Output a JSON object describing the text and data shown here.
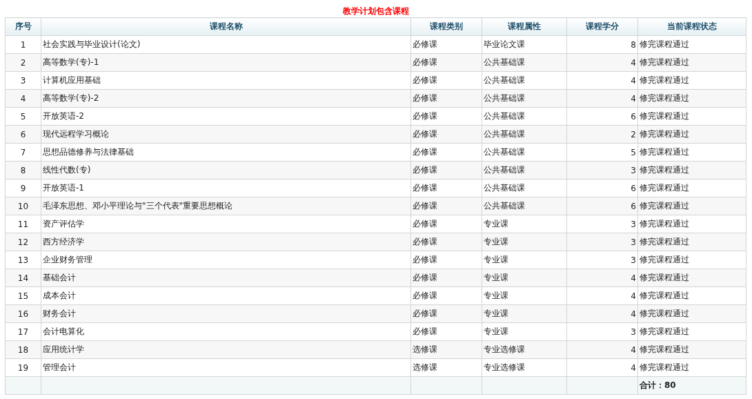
{
  "title": "教学计划包含课程",
  "table": {
    "columns": [
      "序号",
      "课程名称",
      "课程类别",
      "课程属性",
      "课程学分",
      "当前课程状态"
    ],
    "rows": [
      [
        "1",
        "社会实践与毕业设计(论文)",
        "必修课",
        "毕业论文课",
        "8",
        "修完课程通过"
      ],
      [
        "2",
        "高等数学(专)-1",
        "必修课",
        "公共基础课",
        "4",
        "修完课程通过"
      ],
      [
        "3",
        "计算机应用基础",
        "必修课",
        "公共基础课",
        "4",
        "修完课程通过"
      ],
      [
        "4",
        "高等数学(专)-2",
        "必修课",
        "公共基础课",
        "4",
        "修完课程通过"
      ],
      [
        "5",
        "开放英语-2",
        "必修课",
        "公共基础课",
        "6",
        "修完课程通过"
      ],
      [
        "6",
        "现代远程学习概论",
        "必修课",
        "公共基础课",
        "2",
        "修完课程通过"
      ],
      [
        "7",
        "思想品德修养与法律基础",
        "必修课",
        "公共基础课",
        "5",
        "修完课程通过"
      ],
      [
        "8",
        "线性代数(专)",
        "必修课",
        "公共基础课",
        "3",
        "修完课程通过"
      ],
      [
        "9",
        "开放英语-1",
        "必修课",
        "公共基础课",
        "6",
        "修完课程通过"
      ],
      [
        "10",
        "毛泽东思想、邓小平理论与\"三个代表\"重要思想概论",
        "必修课",
        "公共基础课",
        "6",
        "修完课程通过"
      ],
      [
        "11",
        "资产评估学",
        "必修课",
        "专业课",
        "3",
        "修完课程通过"
      ],
      [
        "12",
        "西方经济学",
        "必修课",
        "专业课",
        "3",
        "修完课程通过"
      ],
      [
        "13",
        "企业财务管理",
        "必修课",
        "专业课",
        "3",
        "修完课程通过"
      ],
      [
        "14",
        "基础会计",
        "必修课",
        "专业课",
        "4",
        "修完课程通过"
      ],
      [
        "15",
        "成本会计",
        "必修课",
        "专业课",
        "4",
        "修完课程通过"
      ],
      [
        "16",
        "财务会计",
        "必修课",
        "专业课",
        "4",
        "修完课程通过"
      ],
      [
        "17",
        "会计电算化",
        "必修课",
        "专业课",
        "3",
        "修完课程通过"
      ],
      [
        "18",
        "应用统计学",
        "选修课",
        "专业选修课",
        "4",
        "修完课程通过"
      ],
      [
        "19",
        "管理会计",
        "选修课",
        "专业选修课",
        "4",
        "修完课程通过"
      ]
    ],
    "total": "合计：80"
  }
}
